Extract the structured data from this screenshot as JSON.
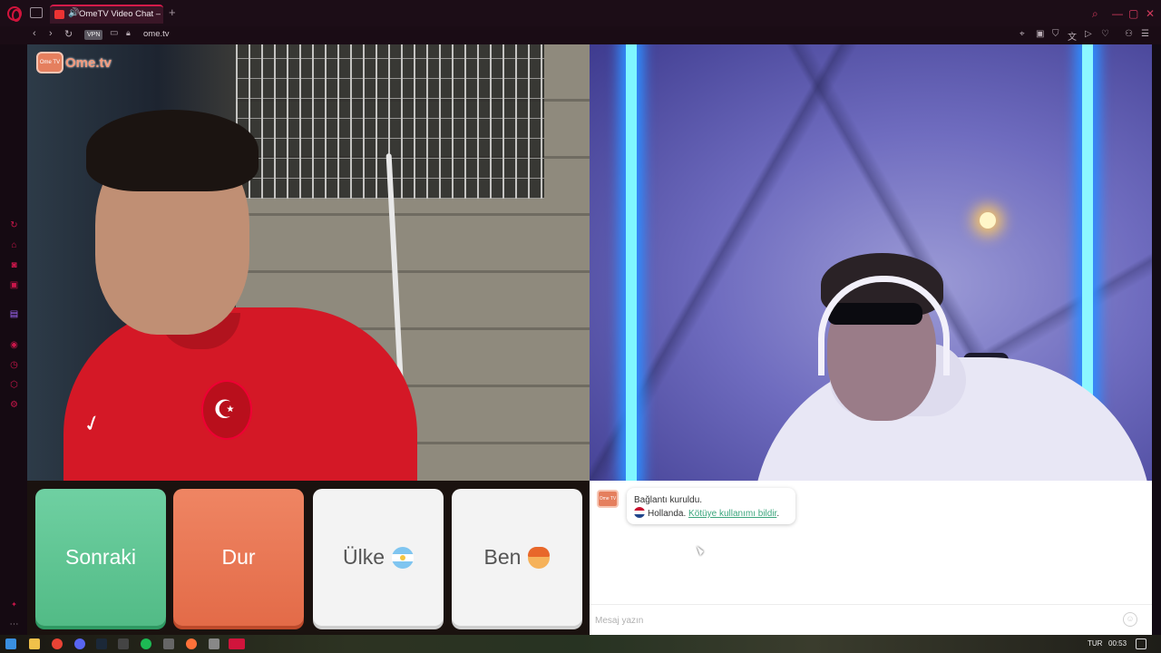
{
  "browser": {
    "tab_title": "OmeTV Video Chat —",
    "new_tab": "+",
    "vpn_badge": "VPN",
    "url": "ome.tv"
  },
  "site": {
    "logo_tv": "Ome TV",
    "logo_name": "Ome.tv"
  },
  "controls": {
    "next_label": "Sonraki",
    "stop_label": "Dur",
    "country_label": "Ülke",
    "me_label": "Ben"
  },
  "chat": {
    "logo_tv": "Ome TV",
    "connected_text": "Bağlantı kuruldu.",
    "country_text": "Hollanda.",
    "report_link": "Kötüye kullanımı bildir",
    "report_suffix": ".",
    "input_placeholder": "Mesaj yazın"
  },
  "taskbar": {
    "language": "TUR",
    "time": "00:53"
  },
  "colors": {
    "next_button": "#5cc592",
    "stop_button": "#e8744f",
    "report_link": "#3aa57c",
    "browser_accent": "#d1143c"
  },
  "icons": [
    "opera-logo-icon",
    "tab-strip-icon",
    "speaker-icon",
    "back-icon",
    "forward-icon",
    "reload-icon",
    "camera-icon",
    "lock-icon",
    "smiley-icon"
  ]
}
